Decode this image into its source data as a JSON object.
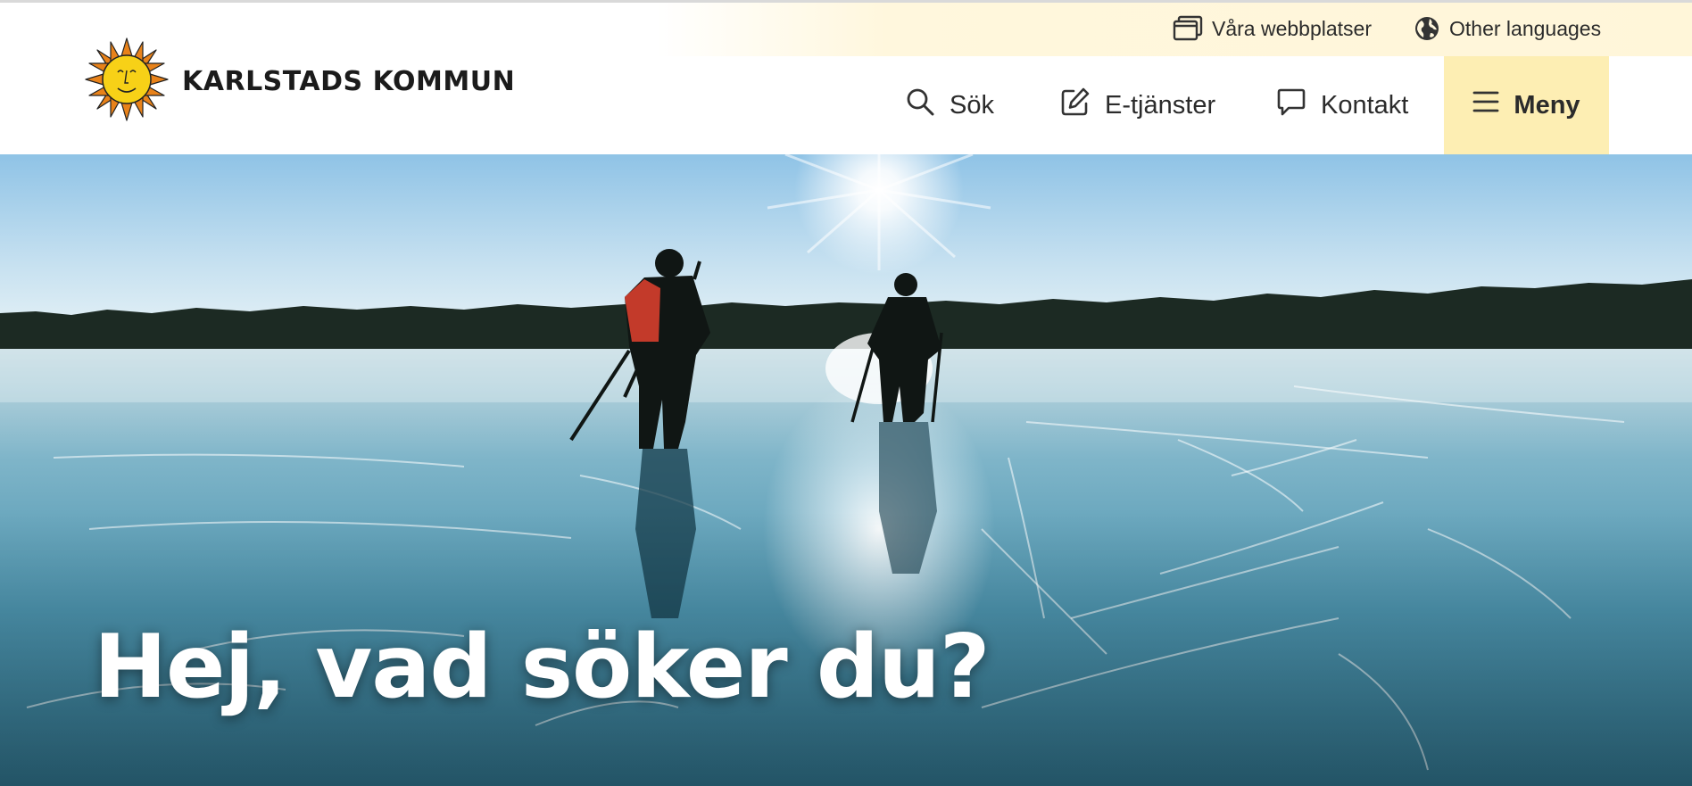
{
  "logo": {
    "text": "KARLSTADS KOMMUN",
    "icon": "sun-icon"
  },
  "utility": {
    "sites_label": "Våra webbplatser",
    "sites_icon": "windows-icon",
    "languages_label": "Other languages",
    "languages_icon": "globe-icon"
  },
  "nav": {
    "search_label": "Sök",
    "search_icon": "search-icon",
    "eservices_label": "E-tjänster",
    "eservices_icon": "edit-icon",
    "contact_label": "Kontakt",
    "contact_icon": "speech-bubble-icon",
    "menu_label": "Meny",
    "menu_icon": "hamburger-icon"
  },
  "hero": {
    "heading": "Hej, vad söker du?"
  },
  "colors": {
    "menu_bg": "#fdeeb3",
    "utility_bg": "#fff7dd",
    "text": "#2b2b2b",
    "logo_sun": "#f7d117",
    "logo_rays": "#e8821a"
  }
}
